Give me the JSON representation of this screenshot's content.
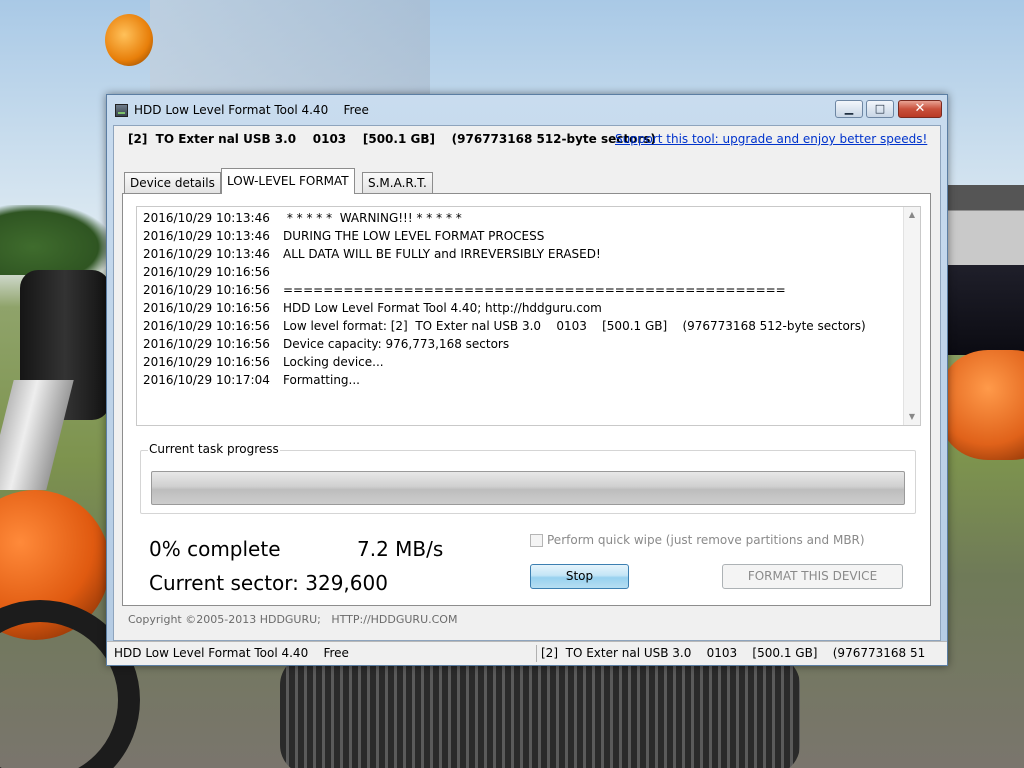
{
  "window": {
    "title": "HDD Low Level Format Tool 4.40    Free",
    "minimize_glyph": "▁",
    "maximize_glyph": "□",
    "close_glyph": "✕"
  },
  "device_line": "[2]  TO Exter nal USB 3.0    0103    [500.1 GB]    (976773168 512-byte sectors)",
  "support_link": "Support this tool: upgrade and enjoy better speeds!",
  "tabs": [
    {
      "label": "Device details",
      "active": false
    },
    {
      "label": "LOW-LEVEL FORMAT",
      "active": true
    },
    {
      "label": "S.M.A.R.T.",
      "active": false
    }
  ],
  "log": [
    {
      "ts": "2016/10/29 10:13:46",
      "msg": " * * * * *  WARNING!!! * * * * *"
    },
    {
      "ts": "2016/10/29 10:13:46",
      "msg": "DURING THE LOW LEVEL FORMAT PROCESS"
    },
    {
      "ts": "2016/10/29 10:13:46",
      "msg": "ALL DATA WILL BE FULLY and IRREVERSIBLY ERASED!"
    },
    {
      "ts": "2016/10/29 10:16:56",
      "msg": ""
    },
    {
      "ts": "2016/10/29 10:16:56",
      "msg": "=================================================="
    },
    {
      "ts": "2016/10/29 10:16:56",
      "msg": "HDD Low Level Format Tool 4.40; http://hddguru.com"
    },
    {
      "ts": "2016/10/29 10:16:56",
      "msg": "Low level format: [2]  TO Exter nal USB 3.0    0103    [500.1 GB]    (976773168 512-byte sectors)"
    },
    {
      "ts": "2016/10/29 10:16:56",
      "msg": "Device capacity: 976,773,168 sectors"
    },
    {
      "ts": "2016/10/29 10:16:56",
      "msg": "Locking device..."
    },
    {
      "ts": "2016/10/29 10:17:04",
      "msg": "Formatting..."
    }
  ],
  "scroll_up_glyph": "▲",
  "scroll_down_glyph": "▼",
  "progress": {
    "label": "Current task progress",
    "fraction": 0.0
  },
  "stats": {
    "percent": "0% complete",
    "speed": "7.2 MB/s",
    "sector": "Current sector: 329,600"
  },
  "quick_wipe": {
    "label": "Perform quick wipe (just remove partitions and MBR)",
    "checked": false,
    "enabled": false
  },
  "buttons": {
    "stop": "Stop",
    "format": "FORMAT THIS DEVICE"
  },
  "copyright": "Copyright ©2005-2013 HDDGURU;   HTTP://HDDGURU.COM",
  "statusbar": {
    "left": "HDD Low Level Format Tool 4.40    Free",
    "right": "[2]  TO Exter nal USB 3.0    0103    [500.1 GB]    (976773168 51"
  },
  "colors": {
    "link": "#0033cc",
    "stop_border": "#3c7fb1",
    "close_red": "#c9503b"
  }
}
